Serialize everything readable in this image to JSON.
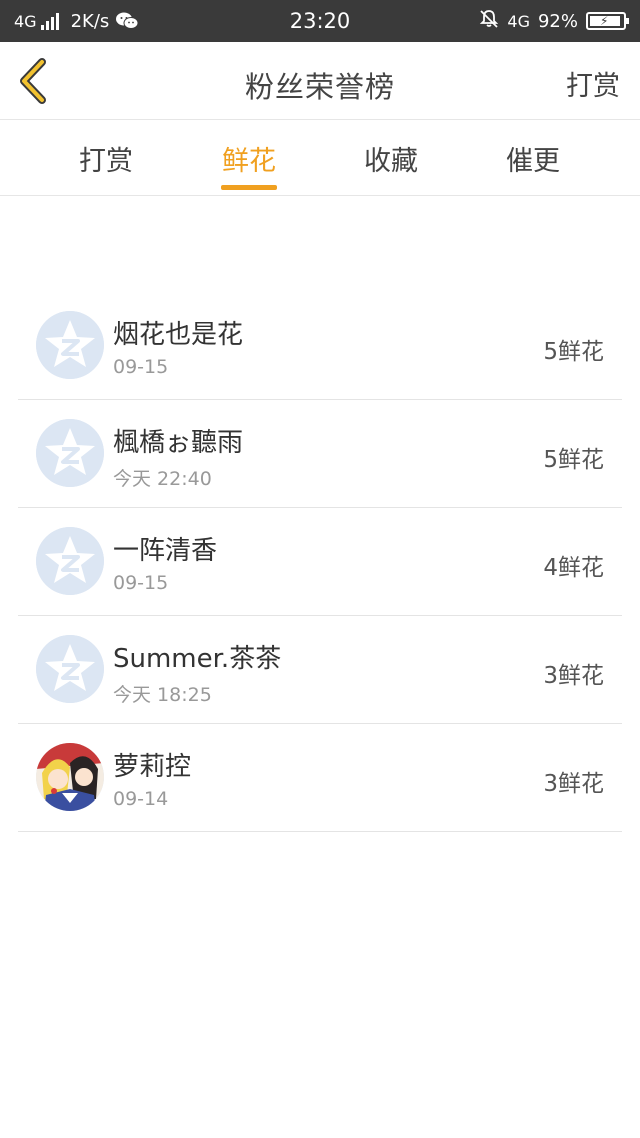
{
  "status_bar": {
    "network_left": "4G",
    "speed": "2K/s",
    "time": "23:20",
    "network_right": "4G",
    "battery": "92%"
  },
  "nav": {
    "title": "粉丝荣誉榜",
    "action": "打赏"
  },
  "tabs": [
    {
      "label": "打赏",
      "active": false
    },
    {
      "label": "鲜花",
      "active": true
    },
    {
      "label": "收藏",
      "active": false
    },
    {
      "label": "催更",
      "active": false
    }
  ],
  "accent_color": "#f0a020",
  "fans": [
    {
      "name": "烟花也是花",
      "time": "09-15",
      "count": "5鲜花",
      "avatar": "default-avatar-icon"
    },
    {
      "name": "楓橋ぉ聽雨",
      "time": "今天 22:40",
      "count": "5鲜花",
      "avatar": "default-avatar-icon"
    },
    {
      "name": "一阵清香",
      "time": "09-15",
      "count": "4鲜花",
      "avatar": "default-avatar-icon"
    },
    {
      "name": "Summer.茶茶",
      "time": "今天 18:25",
      "count": "3鲜花",
      "avatar": "default-avatar-icon"
    },
    {
      "name": "萝莉控",
      "time": "09-14",
      "count": "3鲜花",
      "avatar": "anime-avatar-picture"
    }
  ]
}
